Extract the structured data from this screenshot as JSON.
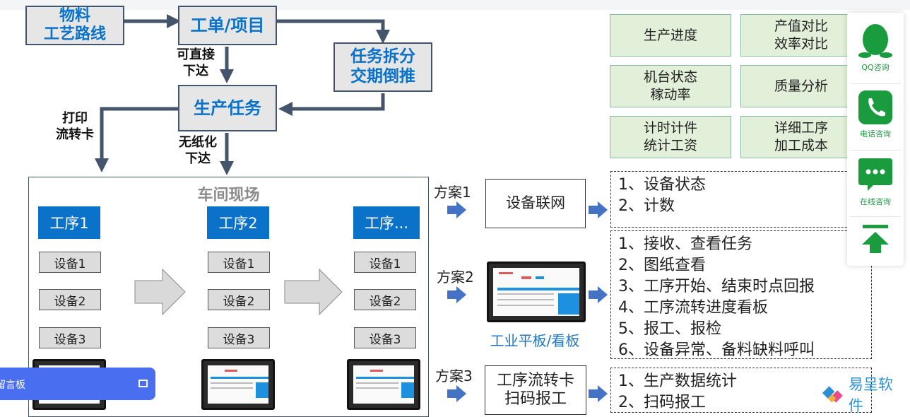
{
  "flow": {
    "material": "物料\n工艺路线",
    "workorder": "工单/项目",
    "taskSplit": "任务拆分\n交期倒推",
    "prodTask": "生产任务",
    "directIssue": "可直接\n下达",
    "printCard": "打印\n流转卡",
    "paperless": "无纸化\n下达"
  },
  "reports": [
    "生产进度",
    "产值对比\n效率对比",
    "机台状态\n稼动率",
    "质量分析",
    "计时计件\n统计工资",
    "详细工序\n加工成本"
  ],
  "workshop": {
    "title": "车间现场",
    "processes": [
      "工序1",
      "工序2",
      "工序..."
    ],
    "devices": [
      "设备1",
      "设备2",
      "设备3"
    ]
  },
  "plans": [
    {
      "label": "方案1",
      "box": "设备联网",
      "items": [
        "1、设备状态",
        "2、计数"
      ]
    },
    {
      "label": "方案2",
      "caption": "工业平板/看板",
      "items": [
        "1、接收、查看任务",
        "2、图纸查看",
        "3、工序开始、结束时点回报",
        "4、工序流转进度看板",
        "5、报工、报检",
        "6、设备异常、备料缺料呼叫"
      ]
    },
    {
      "label": "方案3",
      "box": "工序流转卡\n扫码报工",
      "items": [
        "1、生产数据统计",
        "2、扫码报工"
      ]
    }
  ],
  "sidebar": {
    "qq": "QQ咨询",
    "phone": "电话咨询",
    "online": "在线咨询"
  },
  "message_bar": {
    "label": "留言板"
  },
  "brand": {
    "name": "易呈软件"
  },
  "colors": {
    "blue": "#0a72c8",
    "arrow": "#44546a",
    "green": "#e2f0d9",
    "planArrow": "#4472c4",
    "sideGreen": "#1a9b3e",
    "msgBar": "#4a6ef0"
  }
}
